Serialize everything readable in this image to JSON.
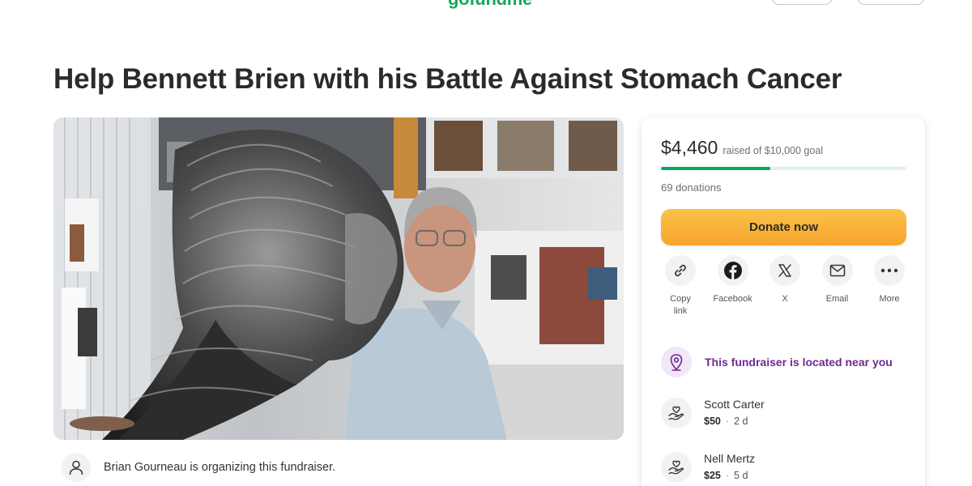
{
  "header": {
    "logo": "gofundme"
  },
  "campaign": {
    "title": "Help Bennett Brien with his Battle Against Stomach Cancer",
    "organizer_text": "Brian Gourneau is organizing this fundraiser."
  },
  "donation_card": {
    "raised_amount": "$4,460",
    "raised_goal_text": "raised of $10,000 goal",
    "progress_fraction": 0.446,
    "donations_count": "69 donations",
    "donate_label": "Donate now",
    "share": [
      {
        "label": "Copy link",
        "icon": "link-icon"
      },
      {
        "label": "Facebook",
        "icon": "facebook-icon"
      },
      {
        "label": "X",
        "icon": "x-icon"
      },
      {
        "label": "Email",
        "icon": "mail-icon"
      },
      {
        "label": "More",
        "icon": "more-icon"
      }
    ],
    "nearby_text": "This fundraiser is located near you",
    "donors": [
      {
        "name": "Scott Carter",
        "amount": "$50",
        "time": "2 d"
      },
      {
        "name": "Nell Mertz",
        "amount": "$25",
        "time": "5 d"
      }
    ]
  },
  "colors": {
    "brand_green": "#02a95c",
    "donate_orange": "#f7a42c",
    "nearby_purple": "#6e2a91"
  }
}
